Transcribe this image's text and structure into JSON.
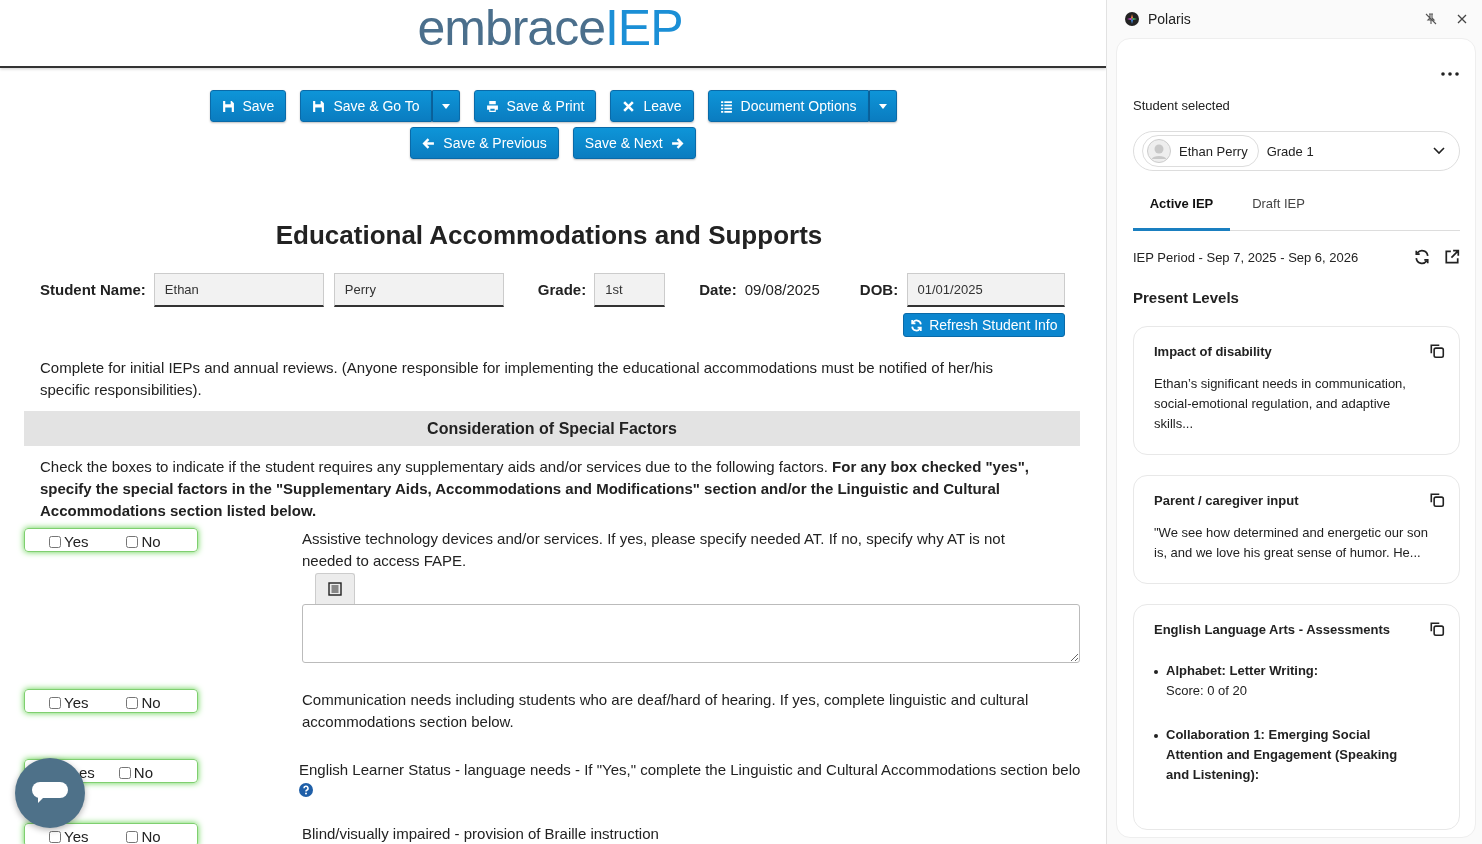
{
  "logo": {
    "part_1": "embrace",
    "part_2": "IEP"
  },
  "toolbar": [
    [
      {
        "label": "Save",
        "kind": "save",
        "dropdown": false
      },
      {
        "label": "Save & Go To",
        "kind": "save",
        "dropdown": true
      },
      {
        "label": "Save & Print",
        "kind": "print",
        "dropdown": false
      },
      {
        "label": "Leave",
        "kind": "leave",
        "dropdown": false
      },
      {
        "label": "Document Options",
        "kind": "options",
        "dropdown": true
      }
    ],
    [
      {
        "label": "Save & Previous",
        "kind": "previous",
        "dropdown": false
      },
      {
        "label": "Save & Next",
        "kind": "next",
        "dropdown": false
      }
    ]
  ],
  "page_title": "Educational Accommodations and Supports",
  "student": {
    "name_label": "Student Name:",
    "first_name": "Ethan",
    "last_name": "Perry",
    "grade_label": "Grade:",
    "grade": "1st",
    "date_label": "Date:",
    "date": "09/08/2025",
    "dob_label": "DOB:",
    "dob": "01/01/2025",
    "refresh_button": "Refresh Student Info"
  },
  "intro": "Complete for initial IEPs and annual reviews. (Anyone responsible for implementing the educational accommodations must be notified of her/his specific responsibilities).",
  "section_title": "Consideration of Special Factors",
  "instructions": "Check the boxes to indicate if the student requires any supplementary aids and/or services due to the following factors. **For any box checked \"yes\", specify the special factors in the \"Supplementary Aids, Accommodations and Modifications\" section and/or the Linguistic and Cultural Accommodations section listed below.**",
  "factors": [
    {
      "kind": "textarea",
      "options": [
        {
          "label": "Yes",
          "checked": false
        },
        {
          "label": "No",
          "checked": false
        }
      ],
      "text": "Assistive technology devices and/or services. If yes, please specify needed AT. If no, specify why AT is not needed to access FAPE."
    },
    {
      "kind": "plain",
      "options": [
        {
          "label": "Yes",
          "checked": false
        },
        {
          "label": "No",
          "checked": false
        }
      ],
      "text": "Communication needs including students who are deaf/hard of hearing. If yes, complete linguistic and cultural accommodations section below."
    },
    {
      "kind": "help",
      "options": [
        {
          "label": "es"
        },
        {
          "label": "No",
          "checked": false
        }
      ],
      "text": "English Learner Status - language needs - If \"Yes,\" complete the Linguistic and Cultural Accommodations section belo"
    },
    {
      "kind": "plain",
      "options": [
        {
          "label": "Yes",
          "checked": false
        },
        {
          "label": "No",
          "checked": false
        }
      ],
      "text": "Blind/visually impaired - provision of Braille instruction"
    }
  ],
  "panel": {
    "title": "Polaris",
    "student_label": "Student selected",
    "student_name": "Ethan Perry",
    "student_grade": "Grade 1",
    "tabs": [
      {
        "label": "Active IEP",
        "selected": true
      },
      {
        "label": "Draft IEP",
        "selected": false
      }
    ],
    "period": "IEP Period - Sep 7, 2025 - Sep 6, 2026",
    "section": "Present Levels",
    "cards": [
      {
        "kind": "text",
        "title": "Impact of disability",
        "text": "Ethan’s significant needs in communication, social-emotional regulation, and adaptive skills..."
      },
      {
        "kind": "text",
        "title": "Parent / caregiver input",
        "text": "\"We see how determined and energetic our son is, and we love his great sense of humor. He..."
      },
      {
        "kind": "list",
        "title": "English Language Arts - Assessments",
        "items": [
          {
            "name": "Alphabet: Letter Writing:",
            "score": "Score: 0 of 20"
          },
          {
            "name": "Collaboration 1: Emerging Social Attention and Engagement (Speaking and Listening):"
          }
        ]
      }
    ]
  }
}
